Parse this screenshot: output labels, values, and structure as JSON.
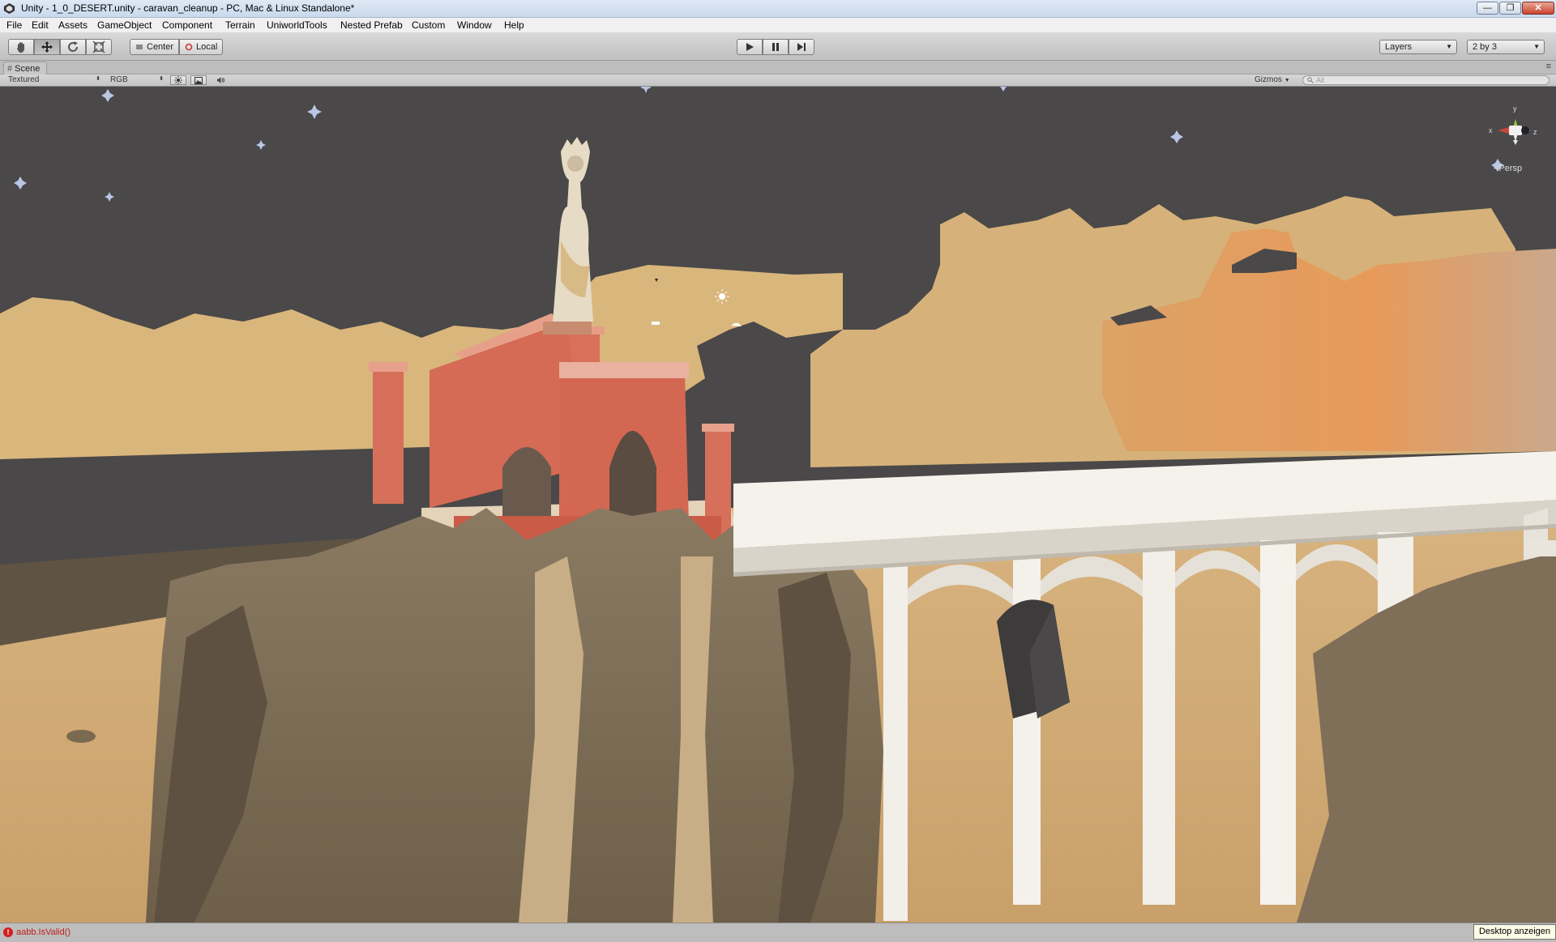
{
  "window": {
    "title": "Unity - 1_0_DESERT.unity - caravan_cleanup - PC, Mac & Linux Standalone*",
    "minimize_glyph": "—",
    "maximize_glyph": "❐",
    "close_glyph": "✕"
  },
  "menu": {
    "items": [
      "File",
      "Edit",
      "Assets",
      "GameObject",
      "Component",
      "Terrain",
      "UniworldTools",
      "Nested Prefab",
      "Custom",
      "Window",
      "Help"
    ]
  },
  "toolbar": {
    "tools": [
      {
        "icon": "hand-icon"
      },
      {
        "icon": "move-icon"
      },
      {
        "icon": "rotate-icon"
      },
      {
        "icon": "scale-icon"
      }
    ],
    "pivot_label": "Center",
    "space_label": "Local",
    "play_icons": [
      "play-icon",
      "pause-icon",
      "step-icon"
    ],
    "layers_label": "Layers",
    "layout_label": "2 by 3"
  },
  "scene": {
    "tab_label": "Scene",
    "render_mode": "Textured",
    "color_mode": "RGB",
    "gizmos_label": "Gizmos",
    "search_placeholder": "All",
    "projection_label": "Persp",
    "axis_labels": {
      "x": "x",
      "y": "y",
      "z": "z"
    }
  },
  "status": {
    "error_message": "aabb.IsValid()",
    "error_glyph": "!"
  },
  "taskbar_tooltip": "Desktop anzeigen",
  "colors": {
    "viewport_bg": "#4a4848",
    "sand": "#d6b47c",
    "rock": "#7d6c55",
    "temple": "#d86f57",
    "aqueduct": "#f4f1ea",
    "error": "#c31c1c"
  }
}
